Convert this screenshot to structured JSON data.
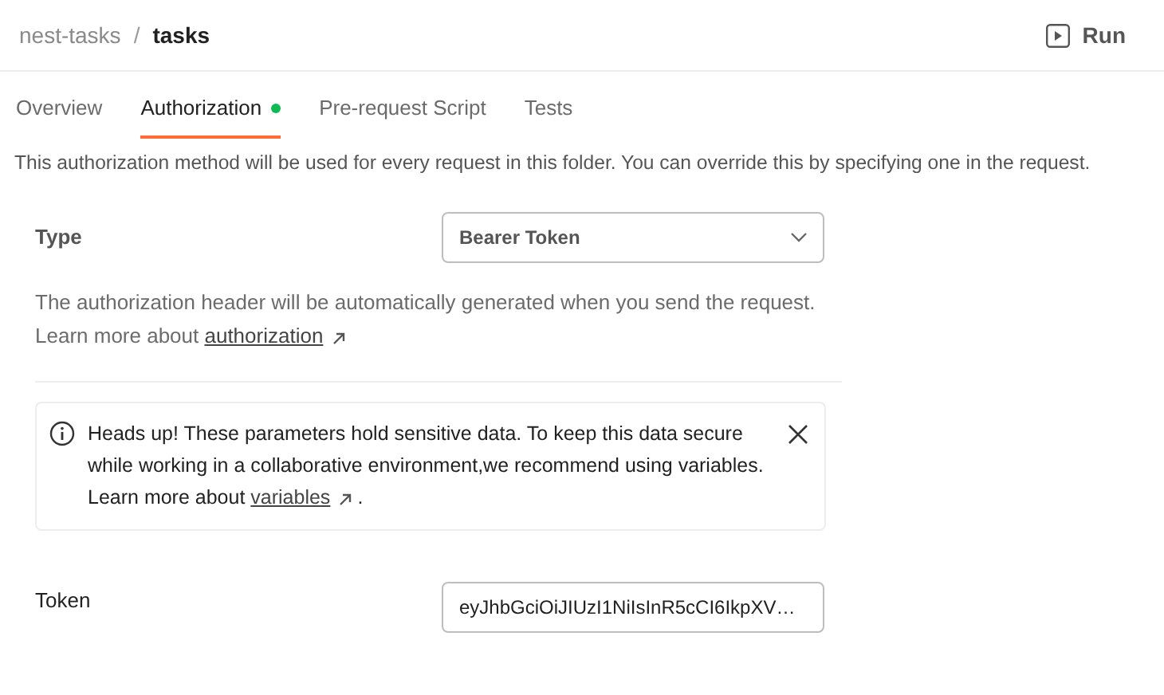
{
  "breadcrumb": [
    {
      "label": "nest-tasks",
      "current": false
    },
    {
      "label": "tasks",
      "current": true
    }
  ],
  "breadcrumb_separator": "/",
  "run_button": {
    "label": "Run"
  },
  "tabs": [
    {
      "label": "Overview",
      "selected": false,
      "dot": false
    },
    {
      "label": "Authorization",
      "selected": true,
      "dot": true
    },
    {
      "label": "Pre-request Script",
      "selected": false,
      "dot": false
    },
    {
      "label": "Tests",
      "selected": false,
      "dot": false
    }
  ],
  "description": "This authorization method will be used for every request in this folder. You can override this by specifying one in the request.",
  "type": {
    "label": "Type",
    "value": "Bearer Token",
    "help": "The authorization header will be automatically generated when you send the request.",
    "learn_prefix": "Learn more about ",
    "learn_link": "authorization"
  },
  "alert": {
    "text": "Heads up! These parameters hold sensitive data. To keep this data secure while working in a collaborative environment,we recommend using variables.",
    "learn_prefix": "Learn more about ",
    "learn_link": "variables",
    "learn_suffix": " ."
  },
  "token": {
    "label": "Token",
    "value": "eyJhbGciOiJIUzI1NiIsInR5cCI6IkpXV…"
  }
}
